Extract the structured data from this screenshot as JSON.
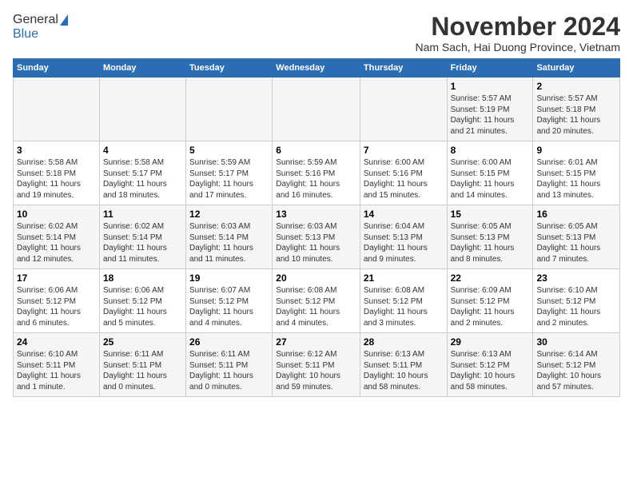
{
  "logo": {
    "general": "General",
    "blue": "Blue"
  },
  "title": "November 2024",
  "subtitle": "Nam Sach, Hai Duong Province, Vietnam",
  "days_header": [
    "Sunday",
    "Monday",
    "Tuesday",
    "Wednesday",
    "Thursday",
    "Friday",
    "Saturday"
  ],
  "weeks": [
    [
      {
        "day": "",
        "detail": ""
      },
      {
        "day": "",
        "detail": ""
      },
      {
        "day": "",
        "detail": ""
      },
      {
        "day": "",
        "detail": ""
      },
      {
        "day": "",
        "detail": ""
      },
      {
        "day": "1",
        "detail": "Sunrise: 5:57 AM\nSunset: 5:19 PM\nDaylight: 11 hours\nand 21 minutes."
      },
      {
        "day": "2",
        "detail": "Sunrise: 5:57 AM\nSunset: 5:18 PM\nDaylight: 11 hours\nand 20 minutes."
      }
    ],
    [
      {
        "day": "3",
        "detail": "Sunrise: 5:58 AM\nSunset: 5:18 PM\nDaylight: 11 hours\nand 19 minutes."
      },
      {
        "day": "4",
        "detail": "Sunrise: 5:58 AM\nSunset: 5:17 PM\nDaylight: 11 hours\nand 18 minutes."
      },
      {
        "day": "5",
        "detail": "Sunrise: 5:59 AM\nSunset: 5:17 PM\nDaylight: 11 hours\nand 17 minutes."
      },
      {
        "day": "6",
        "detail": "Sunrise: 5:59 AM\nSunset: 5:16 PM\nDaylight: 11 hours\nand 16 minutes."
      },
      {
        "day": "7",
        "detail": "Sunrise: 6:00 AM\nSunset: 5:16 PM\nDaylight: 11 hours\nand 15 minutes."
      },
      {
        "day": "8",
        "detail": "Sunrise: 6:00 AM\nSunset: 5:15 PM\nDaylight: 11 hours\nand 14 minutes."
      },
      {
        "day": "9",
        "detail": "Sunrise: 6:01 AM\nSunset: 5:15 PM\nDaylight: 11 hours\nand 13 minutes."
      }
    ],
    [
      {
        "day": "10",
        "detail": "Sunrise: 6:02 AM\nSunset: 5:14 PM\nDaylight: 11 hours\nand 12 minutes."
      },
      {
        "day": "11",
        "detail": "Sunrise: 6:02 AM\nSunset: 5:14 PM\nDaylight: 11 hours\nand 11 minutes."
      },
      {
        "day": "12",
        "detail": "Sunrise: 6:03 AM\nSunset: 5:14 PM\nDaylight: 11 hours\nand 11 minutes."
      },
      {
        "day": "13",
        "detail": "Sunrise: 6:03 AM\nSunset: 5:13 PM\nDaylight: 11 hours\nand 10 minutes."
      },
      {
        "day": "14",
        "detail": "Sunrise: 6:04 AM\nSunset: 5:13 PM\nDaylight: 11 hours\nand 9 minutes."
      },
      {
        "day": "15",
        "detail": "Sunrise: 6:05 AM\nSunset: 5:13 PM\nDaylight: 11 hours\nand 8 minutes."
      },
      {
        "day": "16",
        "detail": "Sunrise: 6:05 AM\nSunset: 5:13 PM\nDaylight: 11 hours\nand 7 minutes."
      }
    ],
    [
      {
        "day": "17",
        "detail": "Sunrise: 6:06 AM\nSunset: 5:12 PM\nDaylight: 11 hours\nand 6 minutes."
      },
      {
        "day": "18",
        "detail": "Sunrise: 6:06 AM\nSunset: 5:12 PM\nDaylight: 11 hours\nand 5 minutes."
      },
      {
        "day": "19",
        "detail": "Sunrise: 6:07 AM\nSunset: 5:12 PM\nDaylight: 11 hours\nand 4 minutes."
      },
      {
        "day": "20",
        "detail": "Sunrise: 6:08 AM\nSunset: 5:12 PM\nDaylight: 11 hours\nand 4 minutes."
      },
      {
        "day": "21",
        "detail": "Sunrise: 6:08 AM\nSunset: 5:12 PM\nDaylight: 11 hours\nand 3 minutes."
      },
      {
        "day": "22",
        "detail": "Sunrise: 6:09 AM\nSunset: 5:12 PM\nDaylight: 11 hours\nand 2 minutes."
      },
      {
        "day": "23",
        "detail": "Sunrise: 6:10 AM\nSunset: 5:12 PM\nDaylight: 11 hours\nand 2 minutes."
      }
    ],
    [
      {
        "day": "24",
        "detail": "Sunrise: 6:10 AM\nSunset: 5:11 PM\nDaylight: 11 hours\nand 1 minute."
      },
      {
        "day": "25",
        "detail": "Sunrise: 6:11 AM\nSunset: 5:11 PM\nDaylight: 11 hours\nand 0 minutes."
      },
      {
        "day": "26",
        "detail": "Sunrise: 6:11 AM\nSunset: 5:11 PM\nDaylight: 11 hours\nand 0 minutes."
      },
      {
        "day": "27",
        "detail": "Sunrise: 6:12 AM\nSunset: 5:11 PM\nDaylight: 10 hours\nand 59 minutes."
      },
      {
        "day": "28",
        "detail": "Sunrise: 6:13 AM\nSunset: 5:11 PM\nDaylight: 10 hours\nand 58 minutes."
      },
      {
        "day": "29",
        "detail": "Sunrise: 6:13 AM\nSunset: 5:12 PM\nDaylight: 10 hours\nand 58 minutes."
      },
      {
        "day": "30",
        "detail": "Sunrise: 6:14 AM\nSunset: 5:12 PM\nDaylight: 10 hours\nand 57 minutes."
      }
    ]
  ]
}
